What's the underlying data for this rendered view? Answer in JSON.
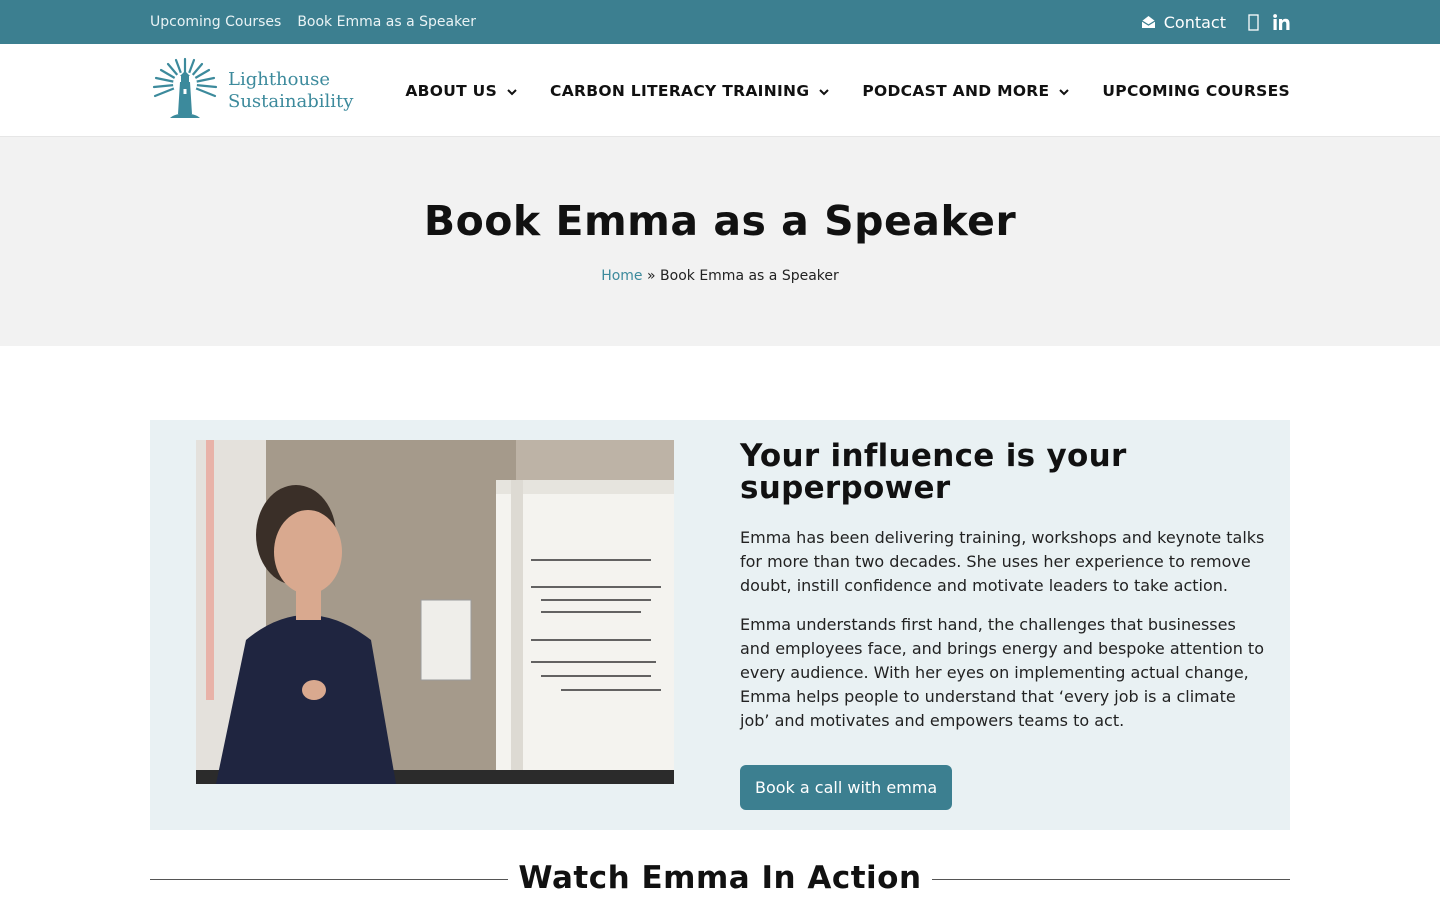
{
  "topbar": {
    "links": [
      "Upcoming Courses",
      "Book Emma as a Speaker"
    ],
    "contact_label": "Contact",
    "icons": [
      "envelope-icon",
      "facebook-icon",
      "linkedin-icon"
    ]
  },
  "logo": {
    "line1": "Lighthouse",
    "line2": "Sustainability"
  },
  "nav": {
    "items": [
      {
        "label": "ABOUT US",
        "has_dropdown": true
      },
      {
        "label": "CARBON LITERACY TRAINING",
        "has_dropdown": true
      },
      {
        "label": "PODCAST AND MORE",
        "has_dropdown": true
      },
      {
        "label": "UPCOMING COURSES",
        "has_dropdown": false
      }
    ]
  },
  "hero": {
    "title": "Book Emma as a Speaker",
    "breadcrumb": {
      "home": "Home",
      "separator": "»",
      "current": "Book Emma as a Speaker"
    }
  },
  "content": {
    "heading": "Your influence is your superpower",
    "paragraph1": "Emma has been delivering training, workshops and keynote talks for more than two decades. She uses her experience to remove doubt, instill confidence and motivate leaders to take action.",
    "paragraph2": "Emma understands first hand, the challenges that businesses and employees face, and brings energy and bespoke attention to every audience. With her eyes on implementing actual change, Emma helps people to understand that ‘every job is a climate job’ and motivates and empowers teams to act.",
    "cta_label": "Book a call with emma"
  },
  "watch": {
    "heading": "Watch Emma In Action"
  },
  "colors": {
    "brand": "#3c7f90",
    "accent": "#3c8a9c",
    "card_bg": "#e9f1f3",
    "hero_bg": "#f2f2f2"
  }
}
